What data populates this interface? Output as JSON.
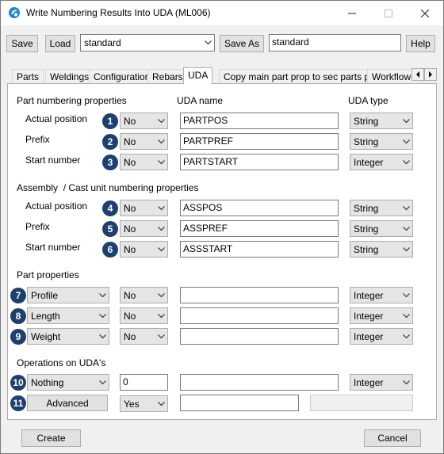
{
  "window": {
    "title": "Write Numbering Results Into UDA (ML006)"
  },
  "toolbar": {
    "save_label": "Save",
    "load_label": "Load",
    "preset_value": "standard",
    "saveas_label": "Save As",
    "saveas_value": "standard",
    "help_label": "Help"
  },
  "tabs": [
    {
      "label": "Parts"
    },
    {
      "label": "Weldings"
    },
    {
      "label": "Configuration"
    },
    {
      "label": "Rebars"
    },
    {
      "label": "UDA"
    },
    {
      "label": "Copy main part prop to sec parts prop"
    },
    {
      "label": "Workflow-s"
    }
  ],
  "headers": {
    "part_numbering": "Part numbering properties",
    "uda_name": "UDA name",
    "uda_type": "UDA type",
    "assembly_a": "Assembly",
    "assembly_sep": "/",
    "assembly_b": "Cast unit numbering properties",
    "part_properties": "Part properties",
    "operations": "Operations on UDA's"
  },
  "part_rows": [
    {
      "label": "Actual position",
      "badge": "1",
      "enabled": "No",
      "uda": "PARTPOS",
      "type": "String"
    },
    {
      "label": "Prefix",
      "badge": "2",
      "enabled": "No",
      "uda": "PARTPREF",
      "type": "String"
    },
    {
      "label": "Start number",
      "badge": "3",
      "enabled": "No",
      "uda": "PARTSTART",
      "type": "Integer"
    }
  ],
  "assembly_rows": [
    {
      "label": "Actual position",
      "badge": "4",
      "enabled": "No",
      "uda": "ASSPOS",
      "type": "String"
    },
    {
      "label": "Prefix",
      "badge": "5",
      "enabled": "No",
      "uda": "ASSPREF",
      "type": "String"
    },
    {
      "label": "Start number",
      "badge": "6",
      "enabled": "No",
      "uda": "ASSSTART",
      "type": "String"
    }
  ],
  "prop_rows": [
    {
      "badge": "7",
      "property": "Profile",
      "enabled": "No",
      "uda": "",
      "type": "Integer"
    },
    {
      "badge": "8",
      "property": "Length",
      "enabled": "No",
      "uda": "",
      "type": "Integer"
    },
    {
      "badge": "9",
      "property": "Weight",
      "enabled": "No",
      "uda": "",
      "type": "Integer"
    }
  ],
  "operation": {
    "badge": "10",
    "mode": "Nothing",
    "value": "0",
    "uda": "",
    "type": "Integer"
  },
  "advanced": {
    "badge": "11",
    "label": "Advanced",
    "enabled": "Yes",
    "uda": ""
  },
  "footer": {
    "create_label": "Create",
    "cancel_label": "Cancel"
  },
  "colors": {
    "badge": "#1f3f6e",
    "app_icon": "#1e88d2"
  },
  "icons": [
    "app-logo-icon",
    "minimize-icon",
    "maximize-icon",
    "close-icon",
    "chevron-down-icon",
    "scroll-left-icon",
    "scroll-right-icon"
  ]
}
